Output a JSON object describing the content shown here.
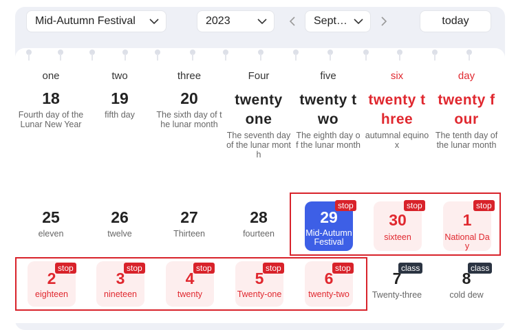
{
  "toolbar": {
    "festival_select": "Mid-Autumn Festival",
    "year_select": "2023",
    "month_select": "Sept…",
    "today_label": "today"
  },
  "weekdays": [
    "one",
    "two",
    "three",
    "Four",
    "five",
    "six",
    "day"
  ],
  "week1": [
    {
      "num": "18",
      "sub": "Fourth day of the Lunar New Year"
    },
    {
      "num": "19",
      "sub": "fifth day"
    },
    {
      "num": "20",
      "sub": "The sixth day of the lunar month"
    },
    {
      "num": "twenty one",
      "sub": "The seventh day of the lunar month"
    },
    {
      "num": "twenty two",
      "sub": "The eighth day of the lunar month"
    },
    {
      "num": "twenty three",
      "sub": "autumnal equinox"
    },
    {
      "num": "twenty four",
      "sub": "The tenth day of the lunar month"
    }
  ],
  "week2": [
    {
      "num": "25",
      "sub": "eleven"
    },
    {
      "num": "26",
      "sub": "twelve"
    },
    {
      "num": "27",
      "sub": "Thirteen"
    },
    {
      "num": "28",
      "sub": "fourteen"
    },
    {
      "num": "29",
      "sub": "Mid-Autumn Festival",
      "tag": "stop"
    },
    {
      "num": "30",
      "sub": "sixteen",
      "tag": "stop"
    },
    {
      "num": "1",
      "sub": "National Day",
      "tag": "stop"
    }
  ],
  "week3": [
    {
      "num": "2",
      "sub": "eighteen",
      "tag": "stop"
    },
    {
      "num": "3",
      "sub": "nineteen",
      "tag": "stop"
    },
    {
      "num": "4",
      "sub": "twenty",
      "tag": "stop"
    },
    {
      "num": "5",
      "sub": "Twenty-one",
      "tag": "stop"
    },
    {
      "num": "6",
      "sub": "twenty-two",
      "tag": "stop"
    },
    {
      "num": "7",
      "sub": "Twenty-three",
      "tag": "class"
    },
    {
      "num": "8",
      "sub": "cold dew",
      "tag": "class"
    }
  ],
  "colors": {
    "holiday_red": "#e0282f",
    "today_blue": "#3d5fe6",
    "workday_tag": "#2b3442"
  }
}
